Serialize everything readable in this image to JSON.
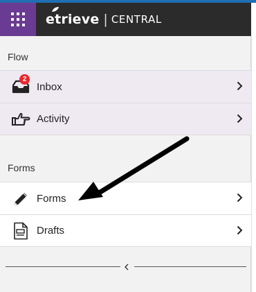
{
  "header": {
    "brand_name": "etrieve",
    "brand_separator": "|",
    "brand_product": "CENTRAL"
  },
  "flow_section": {
    "label": "Flow",
    "items": [
      {
        "label": "Inbox",
        "icon": "inbox-icon",
        "badge": "2"
      },
      {
        "label": "Activity",
        "icon": "pointing-hand-icon"
      }
    ]
  },
  "forms_section": {
    "label": "Forms",
    "items": [
      {
        "label": "Forms",
        "icon": "pencil-icon"
      },
      {
        "label": "Drafts",
        "icon": "document-icon"
      }
    ]
  },
  "colors": {
    "app_grid_bg": "#6a3b92",
    "header_bg": "#2b2b2b",
    "badge": "#e8262b",
    "flow_item_bg": "#efe9f2",
    "top_strip": "#1f6fb2"
  }
}
